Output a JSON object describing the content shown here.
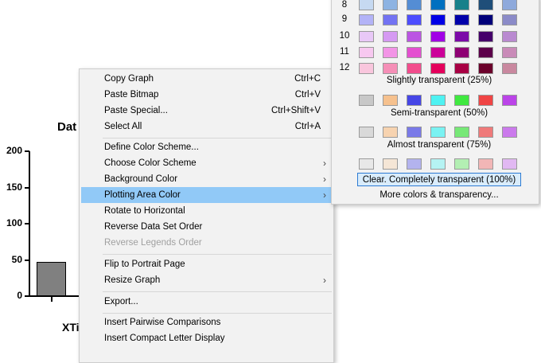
{
  "graph": {
    "title_fragment": "Dat",
    "y_ticks": [
      "200",
      "150",
      "100",
      "50",
      "0"
    ],
    "x_label_fragment": "XTi",
    "bar_value": 47,
    "y_max": 200,
    "bar_color": "#808080"
  },
  "context_menu": {
    "items": [
      {
        "label": "Copy Graph",
        "shortcut": "Ctrl+C"
      },
      {
        "label": "Paste Bitmap",
        "shortcut": "Ctrl+V"
      },
      {
        "label": "Paste Special...",
        "shortcut": "Ctrl+Shift+V"
      },
      {
        "label": "Select All",
        "shortcut": "Ctrl+A"
      },
      {
        "label": "Define Color Scheme..."
      },
      {
        "label": "Choose Color Scheme",
        "submenu": true
      },
      {
        "label": "Background Color",
        "submenu": true
      },
      {
        "label": "Plotting Area Color",
        "submenu": true,
        "selected": true
      },
      {
        "label": "Rotate to Horizontal"
      },
      {
        "label": "Reverse Data Set Order"
      },
      {
        "label": "Reverse Legends Order",
        "disabled": true
      },
      {
        "label": "Flip to Portrait Page"
      },
      {
        "label": "Resize Graph",
        "submenu": true
      },
      {
        "label": "Export..."
      },
      {
        "label": "Insert Pairwise Comparisons"
      },
      {
        "label": "Insert Compact Letter Display"
      }
    ],
    "selected_color": "#91c9f7"
  },
  "color_picker": {
    "rows": [
      {
        "label": "8",
        "colors": [
          "#c6d9f1",
          "#8db3e2",
          "#548dd4",
          "#0070c0",
          "#17818a",
          "#1f4e79",
          "#8ea9db"
        ]
      },
      {
        "label": "9",
        "colors": [
          "#b3b3f7",
          "#7373f2",
          "#4d4dff",
          "#0000e6",
          "#0000aa",
          "#00007a",
          "#8b8bc8"
        ]
      },
      {
        "label": "10",
        "colors": [
          "#e8c8f7",
          "#d59af2",
          "#bb55e3",
          "#a100e6",
          "#7b0aa8",
          "#45006b",
          "#b98ad0"
        ]
      },
      {
        "label": "11",
        "colors": [
          "#f7c8f0",
          "#f294e6",
          "#e44fd0",
          "#cc0099",
          "#8e0073",
          "#5c004a",
          "#c98bb8"
        ]
      },
      {
        "label": "12",
        "colors": [
          "#f9c6dd",
          "#f58fb7",
          "#f24d8d",
          "#e4005c",
          "#a80044",
          "#6b002b",
          "#c9889f"
        ]
      }
    ],
    "slightly_label": "Slightly transparent (25%)",
    "slightly_colors": [
      "#c8c8c8",
      "#f6c18e",
      "#4646e6",
      "#4ff2f2",
      "#40e840",
      "#f04545",
      "#bb44e8"
    ],
    "semi_label": "Semi-transparent (50%)",
    "semi_colors": [
      "#d9d9d9",
      "#f7d3b0",
      "#7a7ae8",
      "#7af2f2",
      "#77e877",
      "#ef7a7a",
      "#cb7aec"
    ],
    "almost_label": "Almost transparent (75%)",
    "almost_colors": [
      "#e8e8e8",
      "#f5e6d6",
      "#b3b3ee",
      "#b5f3f3",
      "#b3efb3",
      "#f2b6b6",
      "#e1b8f2"
    ],
    "clear_label": "Clear. Completely transparent (100%)",
    "more_label": "More colors & transparency..."
  }
}
